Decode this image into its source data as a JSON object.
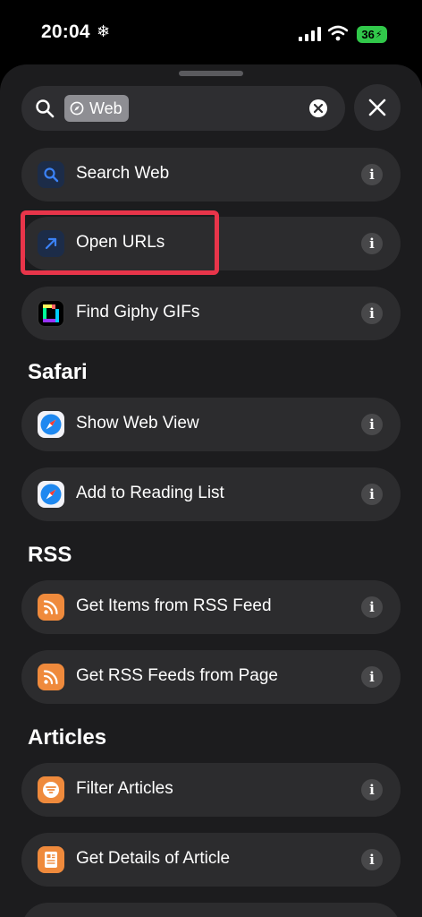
{
  "status": {
    "time": "20:04",
    "snow_glyph": "❄",
    "battery": "36",
    "icons": [
      "signal-icon",
      "wifi-icon",
      "battery-icon"
    ]
  },
  "search": {
    "token_label": "Web",
    "token_icon": "compass-icon"
  },
  "top_actions": [
    {
      "label": "Search Web",
      "icon": "search-icon"
    },
    {
      "label": "Open URLs",
      "icon": "arrow-up-right-icon"
    },
    {
      "label": "Find Giphy GIFs",
      "icon": "giphy-icon"
    }
  ],
  "sections": [
    {
      "title": "Safari",
      "items": [
        {
          "label": "Show Web View",
          "icon": "safari-icon"
        },
        {
          "label": "Add to Reading List",
          "icon": "safari-icon"
        }
      ]
    },
    {
      "title": "RSS",
      "items": [
        {
          "label": "Get Items from RSS Feed",
          "icon": "rss-icon"
        },
        {
          "label": "Get RSS Feeds from Page",
          "icon": "rss-icon"
        }
      ]
    },
    {
      "title": "Articles",
      "items": [
        {
          "label": "Filter Articles",
          "icon": "filter-icon"
        },
        {
          "label": "Get Details of Article",
          "icon": "article-icon"
        }
      ]
    }
  ],
  "info_glyph": "i",
  "colors": {
    "sheet": "#1c1c1e",
    "row": "#2c2c2e",
    "highlight": "#e8354a",
    "rss_orange": "#ef8a3c",
    "battery_green": "#31c84a",
    "accent_blue": "#3b82f6"
  }
}
